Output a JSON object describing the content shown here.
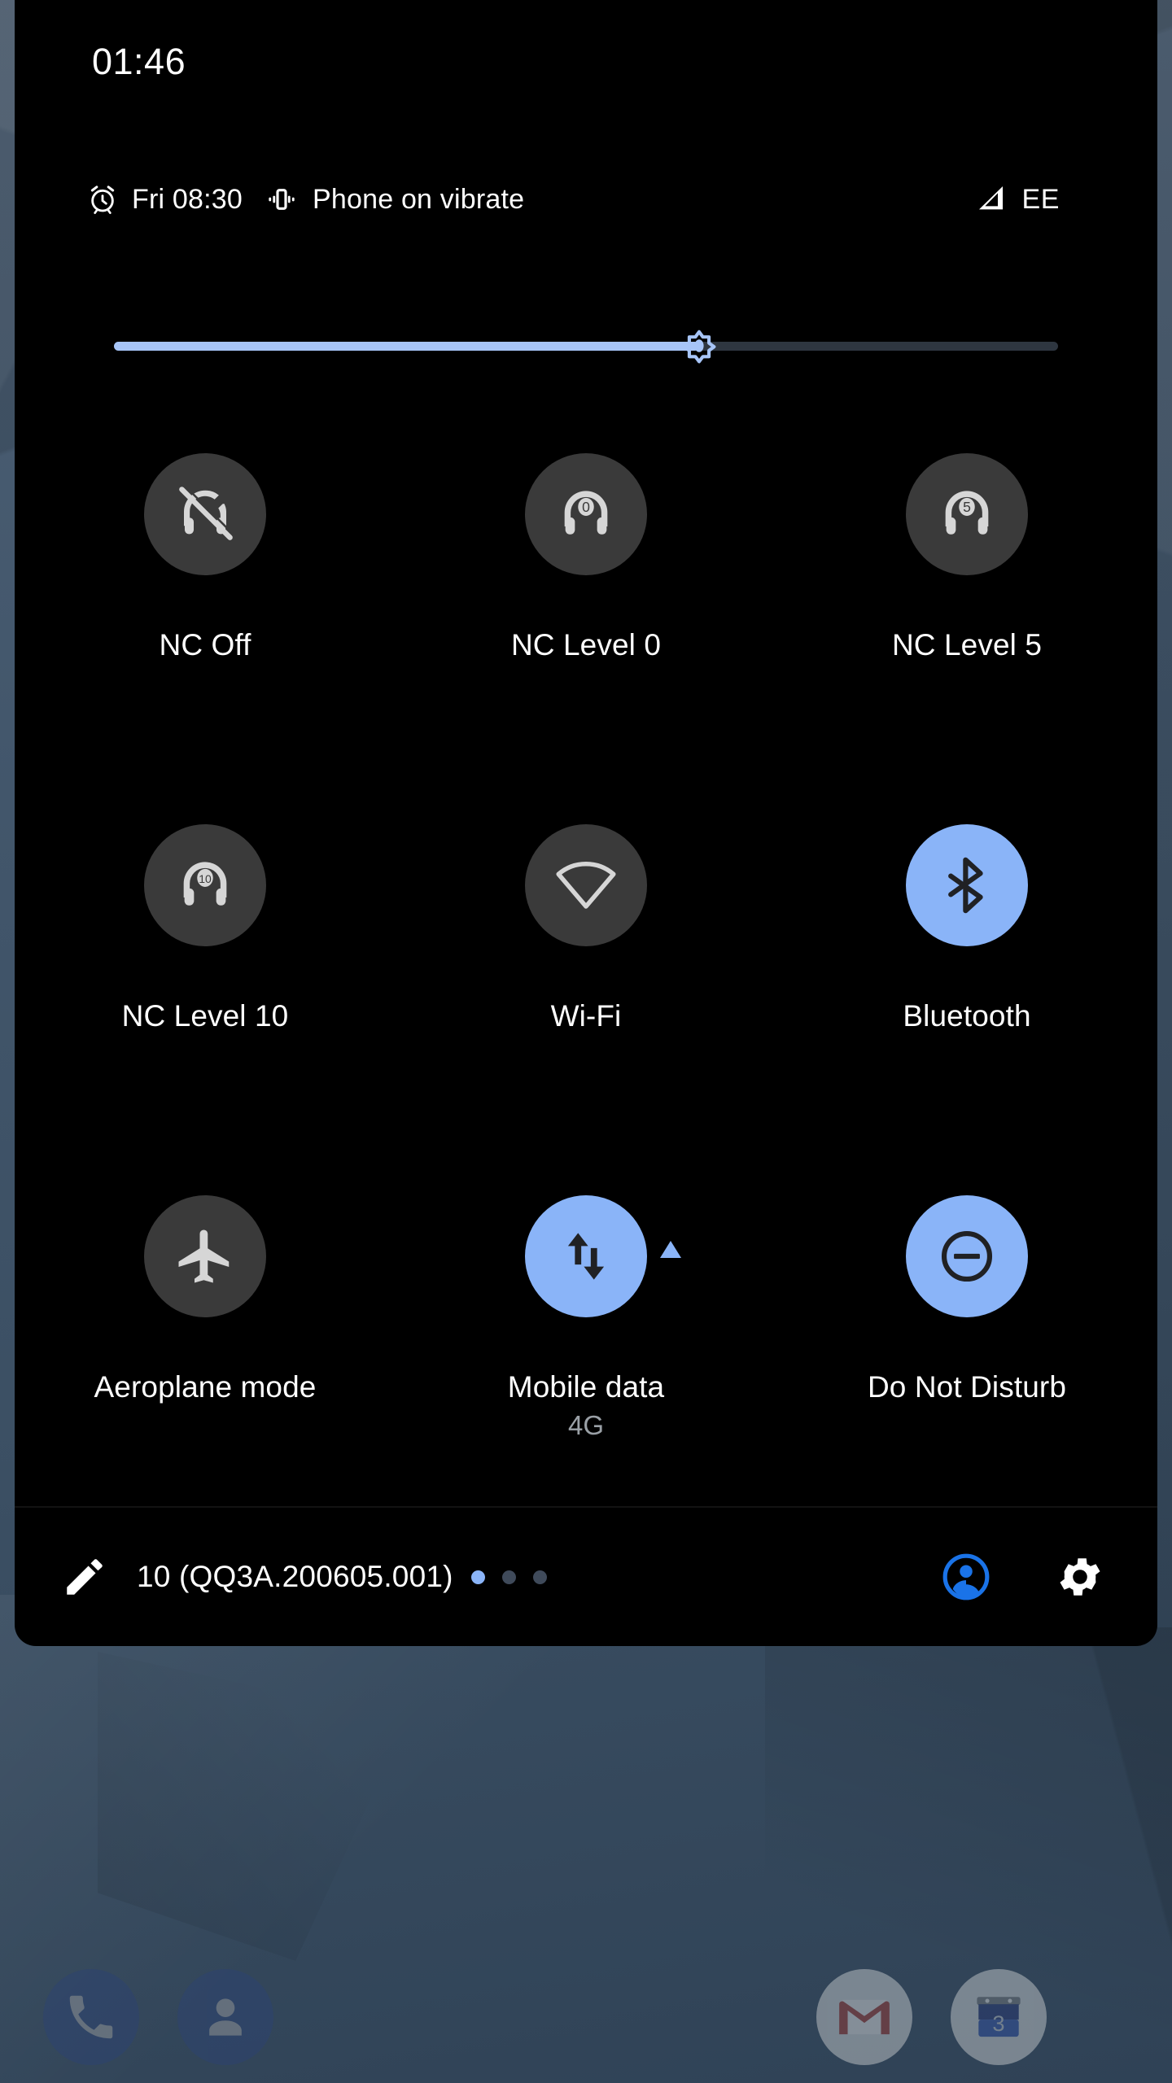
{
  "status_bar": {
    "clock": "01:46",
    "alarm_icon": "alarm-clock-icon",
    "alarm_time": "Fri 08:30",
    "vibrate_icon": "vibrate-icon",
    "ringer_status": "Phone on vibrate",
    "signal_icon": "cellular-signal-icon",
    "carrier": "EE"
  },
  "brightness": {
    "icon": "brightness-sun-icon",
    "value_percent": 62
  },
  "tiles": [
    [
      {
        "label": "NC Off",
        "sub": "",
        "state": "off",
        "icon": "headphones-off-icon",
        "badge": false,
        "level": ""
      },
      {
        "label": "NC Level 0",
        "sub": "",
        "state": "off",
        "icon": "headphones-level-icon",
        "badge": false,
        "level": "0"
      },
      {
        "label": "NC Level 5",
        "sub": "",
        "state": "off",
        "icon": "headphones-level-icon",
        "badge": false,
        "level": "5"
      }
    ],
    [
      {
        "label": "NC Level 10",
        "sub": "",
        "state": "off",
        "icon": "headphones-level-icon",
        "badge": false,
        "level": "10"
      },
      {
        "label": "Wi-Fi",
        "sub": "",
        "state": "off",
        "icon": "wifi-icon",
        "badge": false,
        "level": ""
      },
      {
        "label": "Bluetooth",
        "sub": "",
        "state": "on",
        "icon": "bluetooth-icon",
        "badge": false,
        "level": ""
      }
    ],
    [
      {
        "label": "Aeroplane mode",
        "sub": "",
        "state": "off",
        "icon": "airplane-icon",
        "badge": false,
        "level": ""
      },
      {
        "label": "Mobile data",
        "sub": "4G",
        "state": "on",
        "icon": "data-transfer-icon",
        "badge": true,
        "level": ""
      },
      {
        "label": "Do Not Disturb",
        "sub": "",
        "state": "on",
        "icon": "do-not-disturb-icon",
        "badge": false,
        "level": ""
      }
    ]
  ],
  "footer": {
    "edit_icon": "pencil-edit-icon",
    "build_label": "10 (QQ3A.200605.001)",
    "page_dots": {
      "count": 3,
      "active_index": 0
    },
    "user_icon": "user-account-icon",
    "settings_icon": "gear-settings-icon"
  },
  "dock": [
    {
      "name": "Phone",
      "icon": "phone-icon"
    },
    {
      "name": "Contacts",
      "icon": "contacts-icon"
    },
    {
      "name": "Gmail",
      "icon": "gmail-icon"
    },
    {
      "name": "Calendar",
      "icon": "calendar-icon",
      "day": "3"
    }
  ],
  "colors": {
    "accent_on": "#8ab4f8",
    "tile_off": "#3a3a3a",
    "panel_bg": "#000000",
    "slider_fill": "#a7c5f8",
    "slider_track": "#2e3640",
    "subtitle": "#9aa0a6",
    "user_blue": "#1a73e8"
  }
}
